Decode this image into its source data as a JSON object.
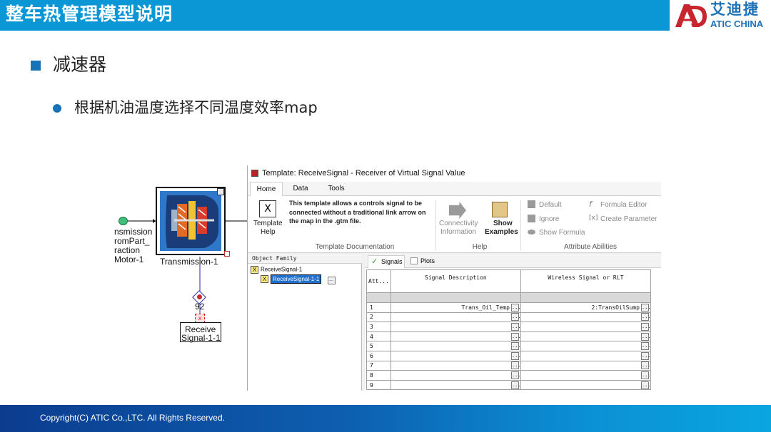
{
  "header": {
    "title": "整车热管理模型说明",
    "logo_cn": "艾迪捷",
    "logo_en": "ATIC CHINA",
    "bar_color": "#0b96d6"
  },
  "content": {
    "heading": "减速器",
    "bullet": "根据机油温度选择不同温度效率map"
  },
  "diagram": {
    "left_label_lines": [
      "nsmission",
      "romPart_",
      "raction",
      "Motor-1"
    ],
    "component_label": "Transmission-1",
    "link_number": "92",
    "receive_label_line1": "Receive",
    "receive_label_line2": "Signal-1-1"
  },
  "window": {
    "title": "Template: ReceiveSignal - Receiver of Virtual Signal Value",
    "tabs": [
      "Home",
      "Data",
      "Tools"
    ],
    "ribbon": {
      "template_help": [
        "Template",
        "Help"
      ],
      "doc_text": "This template allows a controls signal to be connected without a traditional link arrow on the map in the .gtm file.",
      "doc_group": "Template Documentation",
      "connectivity": [
        "Connectivity",
        "Information"
      ],
      "show_examples": [
        "Show",
        "Examples"
      ],
      "help_group": "Help",
      "default": "Default",
      "ignore": "Ignore",
      "show_formula": "Show Formula",
      "formula_editor": "Formula Editor",
      "create_parameter": "Create Parameter",
      "attr_group": "Attribute Abilities"
    },
    "object_family": {
      "header": "Object Family",
      "root": "ReceiveSignal-1",
      "child": "ReceiveSignal-1-1"
    },
    "grid": {
      "tab_signals": "Signals",
      "tab_plots": "Plots",
      "col_att": "Att...",
      "col_desc": "Signal Description",
      "col_wireless": "Wireless Signal or RLT",
      "rows": [
        {
          "n": "1",
          "desc": "Trans_Oil_Temp",
          "wl": "2:TransOilSump"
        },
        {
          "n": "2",
          "desc": "",
          "wl": ""
        },
        {
          "n": "3",
          "desc": "",
          "wl": ""
        },
        {
          "n": "4",
          "desc": "",
          "wl": ""
        },
        {
          "n": "5",
          "desc": "",
          "wl": ""
        },
        {
          "n": "6",
          "desc": "",
          "wl": ""
        },
        {
          "n": "7",
          "desc": "",
          "wl": ""
        },
        {
          "n": "8",
          "desc": "",
          "wl": ""
        },
        {
          "n": "9",
          "desc": "",
          "wl": ""
        }
      ],
      "ellipsis": "..."
    }
  },
  "footer": {
    "copyright": "Copyright(C) ATIC Co.,LTC. All Rights Reserved."
  }
}
